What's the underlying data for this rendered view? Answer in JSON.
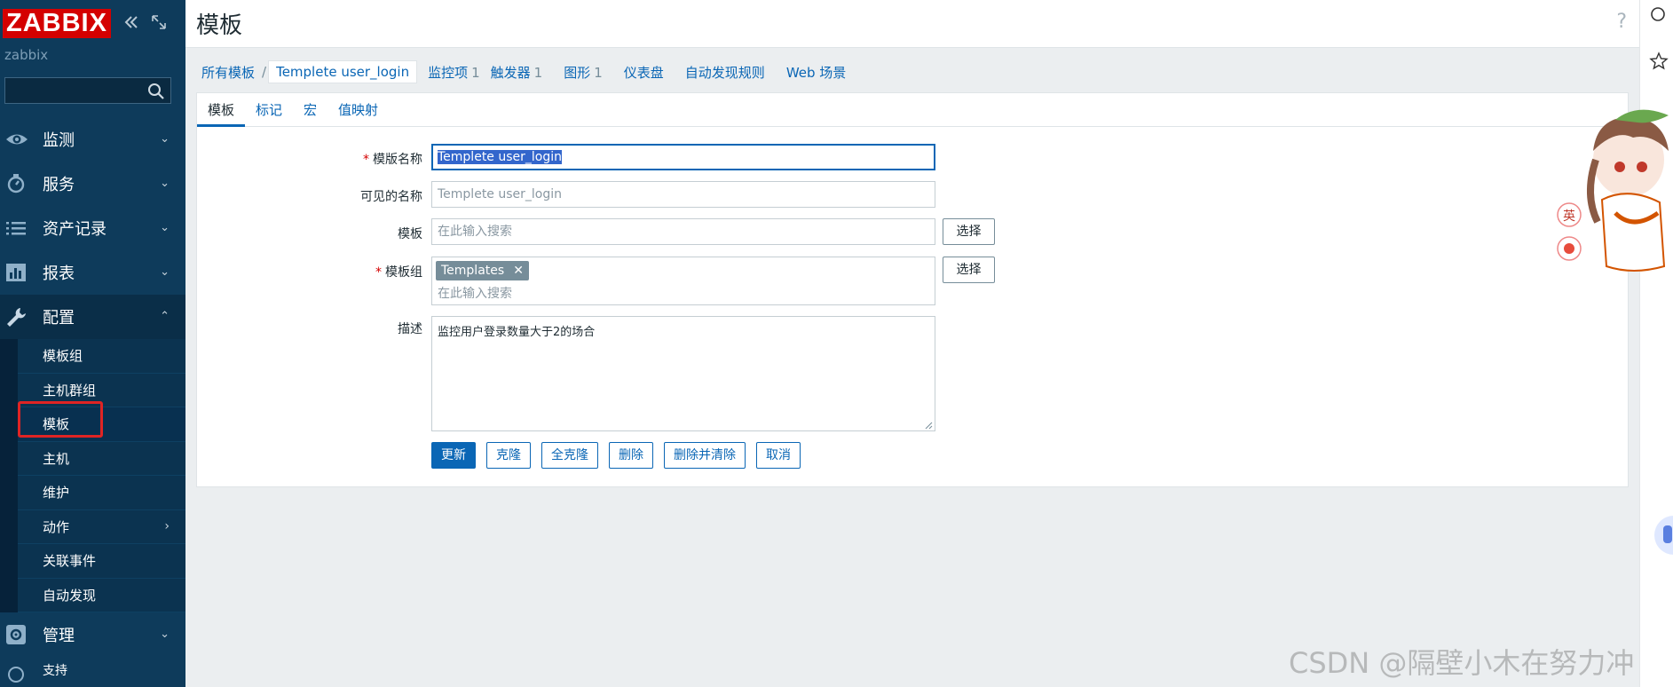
{
  "sidebar": {
    "logo": "ZABBIX",
    "server_name": "zabbix",
    "search_value": "",
    "menu": [
      {
        "label": "监测",
        "icon": "eye-icon"
      },
      {
        "label": "服务",
        "icon": "stopwatch-icon"
      },
      {
        "label": "资产记录",
        "icon": "list-icon"
      },
      {
        "label": "报表",
        "icon": "bar-chart-icon"
      },
      {
        "label": "配置",
        "icon": "wrench-icon"
      },
      {
        "label": "管理",
        "icon": "gear-icon"
      }
    ],
    "submenu": [
      "模板组",
      "主机群组",
      "模板",
      "主机",
      "维护",
      "动作",
      "关联事件",
      "自动发现"
    ],
    "next_item_partial": "支持"
  },
  "header": {
    "title": "模板",
    "help": "?"
  },
  "nav": {
    "all_templates": "所有模板",
    "separator": "/",
    "current": "Templete user_login",
    "items_label": "监控项",
    "items_count": "1",
    "triggers_label": "触发器",
    "triggers_count": "1",
    "graphs_label": "图形",
    "graphs_count": "1",
    "dashboards_label": "仪表盘",
    "discovery_label": "自动发现规则",
    "web_label": "Web 场景"
  },
  "form_tabs": [
    "模板",
    "标记",
    "宏",
    "值映射"
  ],
  "form": {
    "template_name_label": "模版名称",
    "template_name_value": "Templete user_login",
    "visible_name_label": "可见的名称",
    "visible_name_placeholder": "Templete user_login",
    "templates_label": "模板",
    "templates_placeholder": "在此输入搜索",
    "groups_label": "模板组",
    "groups_tag": "Templates",
    "groups_placeholder": "在此输入搜索",
    "description_label": "描述",
    "description_value": "监控用户登录数量大于2的场合",
    "select_label": "选择",
    "required_mark": "*"
  },
  "buttons": {
    "update": "更新",
    "clone": "克隆",
    "full_clone": "全克隆",
    "delete": "删除",
    "delete_clear": "删除并清除",
    "cancel": "取消"
  },
  "mascot": {
    "badge1": "英"
  },
  "watermark": "CSDN @隔壁小木在努力冲",
  "colors": {
    "sidebar_bg": "#0e3b5b",
    "logo_red": "#d40000",
    "link_blue": "#0a66b5",
    "highlight_red": "#e02424"
  }
}
